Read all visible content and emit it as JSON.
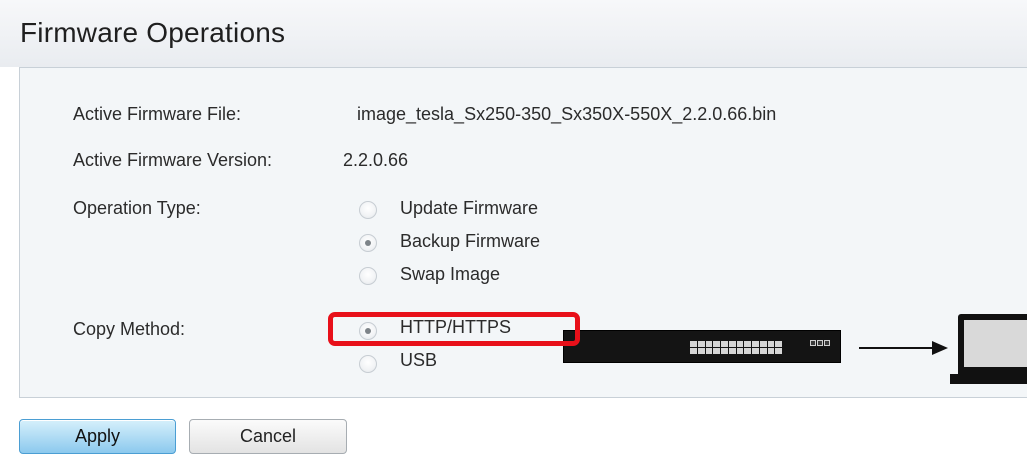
{
  "header": {
    "title": "Firmware Operations"
  },
  "fields": {
    "active_file_label": "Active Firmware File:",
    "active_file_value": "image_tesla_Sx250-350_Sx350X-550X_2.2.0.66.bin",
    "active_version_label": "Active Firmware Version:",
    "active_version_value": "2.2.0.66",
    "operation_type_label": "Operation Type:",
    "copy_method_label": "Copy Method:"
  },
  "operation_type": {
    "options": [
      "Update Firmware",
      "Backup Firmware",
      "Swap Image"
    ],
    "selected": "Backup Firmware"
  },
  "copy_method": {
    "options": [
      "HTTP/HTTPS",
      "USB"
    ],
    "selected": "HTTP/HTTPS"
  },
  "buttons": {
    "apply": "Apply",
    "cancel": "Cancel"
  },
  "colors": {
    "highlight": "#e8101a",
    "apply_button": "#8cc9ee",
    "panel_bg": "#f3f6f8"
  },
  "icons": [
    "network-switch-icon",
    "arrow-right-icon",
    "laptop-icon"
  ]
}
